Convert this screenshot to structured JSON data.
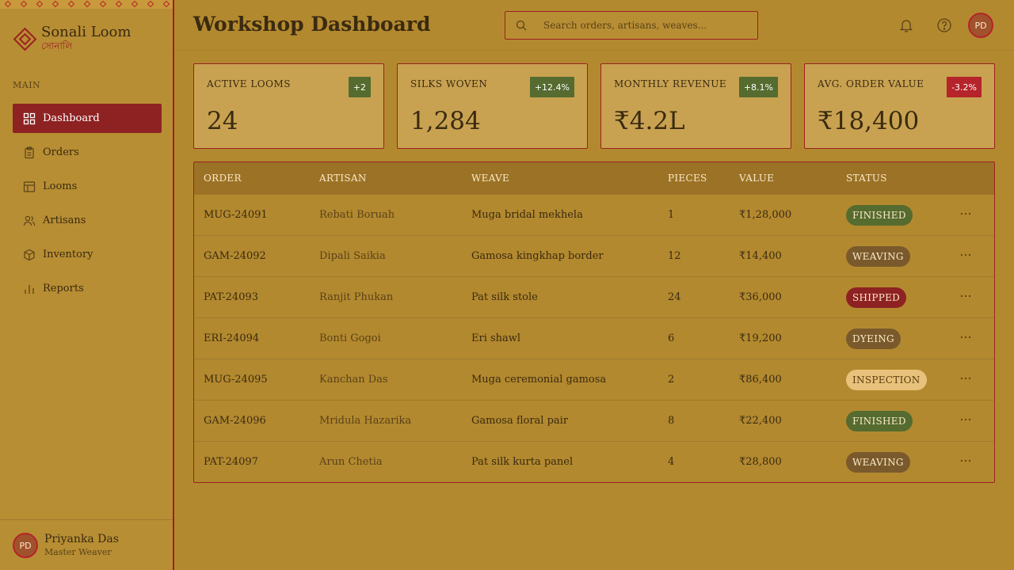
{
  "brand": {
    "name": "Sonali Loom",
    "sub": "সোনালি"
  },
  "nav": {
    "section": "MAIN",
    "items": [
      {
        "label": "Dashboard",
        "icon": "grid-icon",
        "active": true
      },
      {
        "label": "Orders",
        "icon": "clipboard-icon"
      },
      {
        "label": "Looms",
        "icon": "loom-icon"
      },
      {
        "label": "Artisans",
        "icon": "users-icon"
      },
      {
        "label": "Inventory",
        "icon": "box-icon"
      },
      {
        "label": "Reports",
        "icon": "bar-chart-icon"
      }
    ]
  },
  "user": {
    "initials": "PD",
    "name": "Priyanka Das",
    "role": "Master Weaver"
  },
  "header": {
    "title": "Workshop Dashboard",
    "search_placeholder": "Search orders, artisans, weaves...",
    "avatar_initials": "PD"
  },
  "kpis": [
    {
      "label": "ACTIVE LOOMS",
      "value": "24",
      "badge": "+2",
      "badge_color": "#556b2f"
    },
    {
      "label": "SILKS WOVEN",
      "value": "1,284",
      "badge": "+12.4%",
      "badge_color": "#556b2f"
    },
    {
      "label": "MONTHLY REVENUE",
      "value": "₹4.2L",
      "badge": "+8.1%",
      "badge_color": "#556b2f"
    },
    {
      "label": "AVG. ORDER VALUE",
      "value": "₹18,400",
      "badge": "-3.2%",
      "badge_color": "#b5242a"
    }
  ],
  "table": {
    "columns": [
      "ORDER",
      "ARTISAN",
      "WEAVE",
      "PIECES",
      "VALUE",
      "STATUS"
    ],
    "rows": [
      {
        "order": "MUG-24091",
        "artisan": "Rebati Boruah",
        "weave": "Muga bridal mekhela",
        "pieces": "1",
        "value": "₹1,28,000",
        "status": "FINISHED"
      },
      {
        "order": "GAM-24092",
        "artisan": "Dipali Saikia",
        "weave": "Gamosa kingkhap border",
        "pieces": "12",
        "value": "₹14,400",
        "status": "WEAVING"
      },
      {
        "order": "PAT-24093",
        "artisan": "Ranjit Phukan",
        "weave": "Pat silk stole",
        "pieces": "24",
        "value": "₹36,000",
        "status": "SHIPPED"
      },
      {
        "order": "ERI-24094",
        "artisan": "Bonti Gogoi",
        "weave": "Eri shawl",
        "pieces": "6",
        "value": "₹19,200",
        "status": "DYEING"
      },
      {
        "order": "MUG-24095",
        "artisan": "Kanchan Das",
        "weave": "Muga ceremonial gamosa",
        "pieces": "2",
        "value": "₹86,400",
        "status": "INSPECTION"
      },
      {
        "order": "GAM-24096",
        "artisan": "Mridula Hazarika",
        "weave": "Gamosa floral pair",
        "pieces": "8",
        "value": "₹22,400",
        "status": "FINISHED"
      },
      {
        "order": "PAT-24097",
        "artisan": "Arun Chetia",
        "weave": "Pat silk kurta panel",
        "pieces": "4",
        "value": "₹28,800",
        "status": "WEAVING"
      }
    ]
  },
  "colors": {
    "accent": "#8e2222",
    "success": "#556b2f",
    "danger": "#b5242a",
    "background": "#b3892f"
  }
}
